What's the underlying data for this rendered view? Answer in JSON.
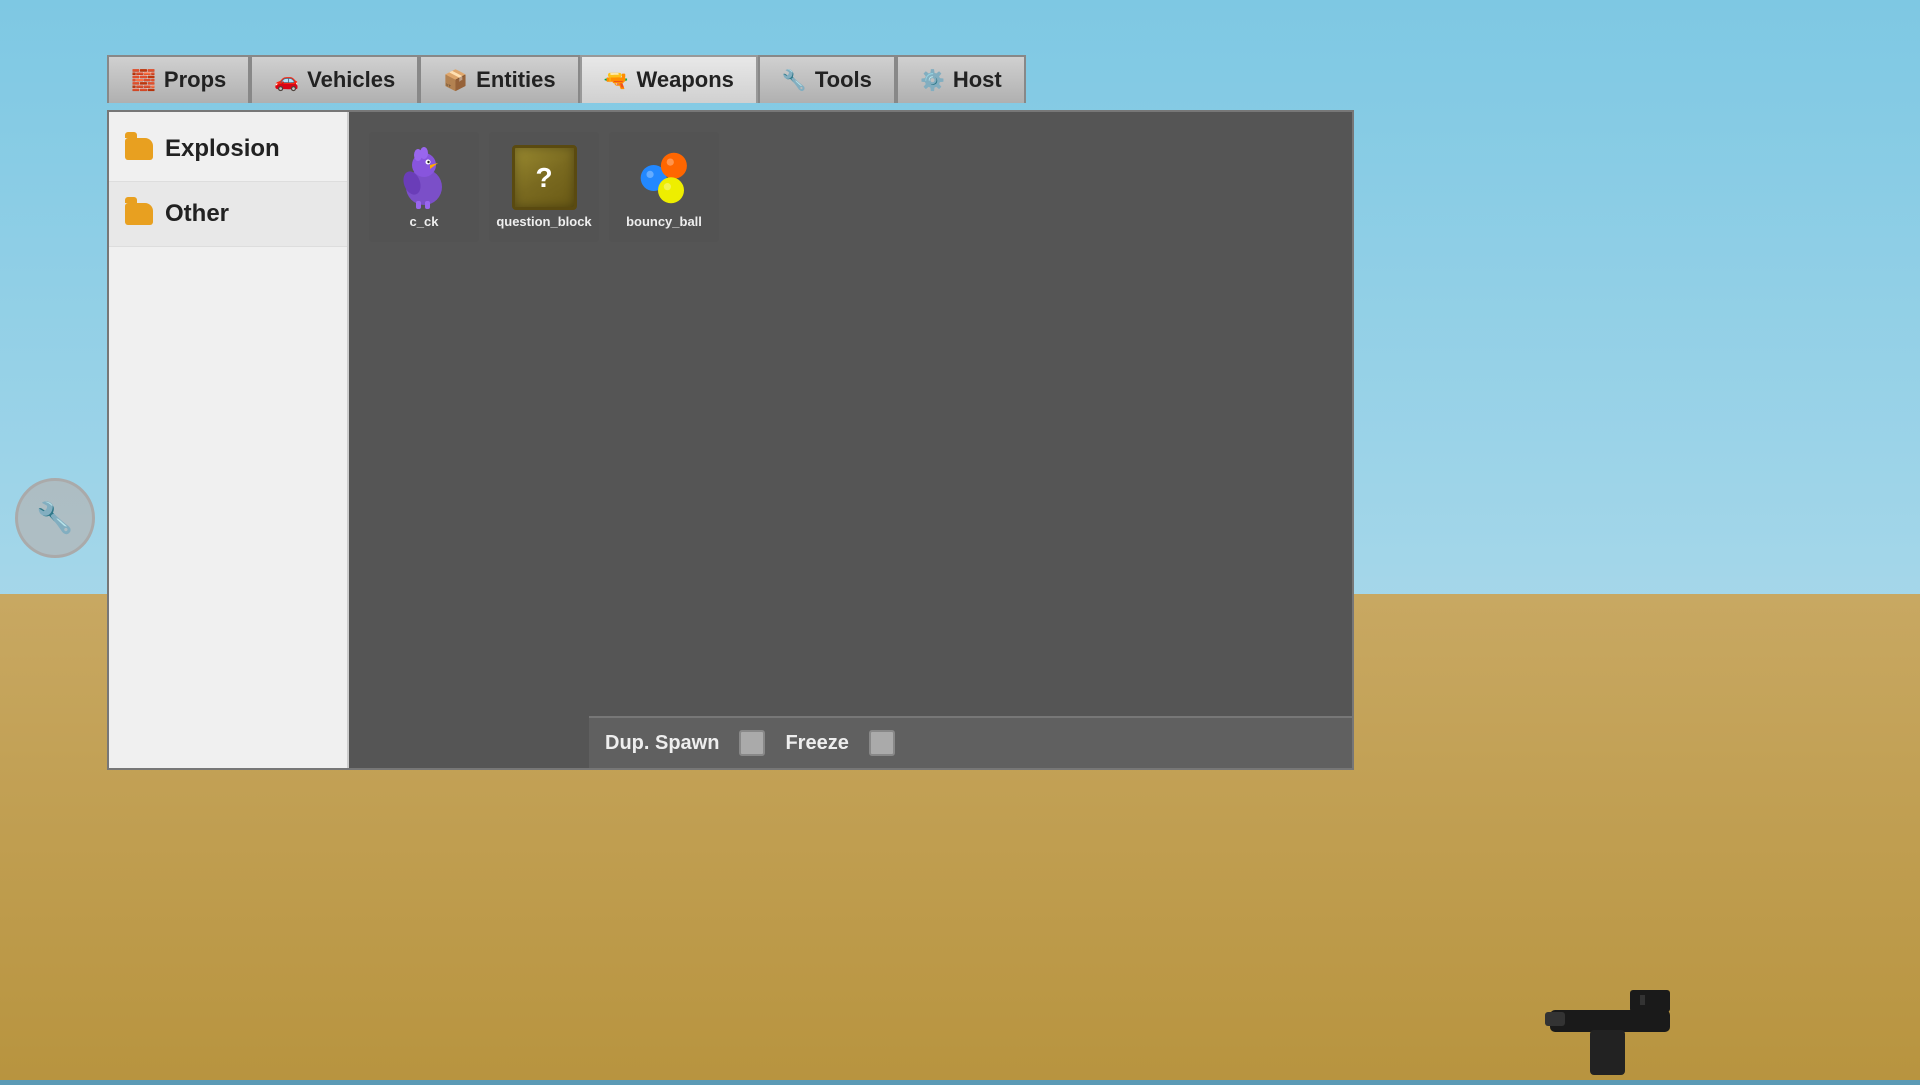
{
  "background": {
    "sky_color": "#7ec8e3",
    "ground_color": "#c8a862"
  },
  "tabs": [
    {
      "id": "props",
      "label": "Props",
      "icon": "🧱",
      "active": false
    },
    {
      "id": "vehicles",
      "label": "Vehicles",
      "icon": "🚗",
      "active": false
    },
    {
      "id": "entities",
      "label": "Entities",
      "icon": "📦",
      "active": false
    },
    {
      "id": "weapons",
      "label": "Weapons",
      "icon": "🔫",
      "active": true
    },
    {
      "id": "tools",
      "label": "Tools",
      "icon": "🔧",
      "active": false
    },
    {
      "id": "host",
      "label": "Host",
      "icon": "⚙️",
      "active": false
    }
  ],
  "sidebar": {
    "items": [
      {
        "id": "explosion",
        "label": "Explosion",
        "active": false
      },
      {
        "id": "other",
        "label": "Other",
        "active": true
      }
    ]
  },
  "content": {
    "items": [
      {
        "id": "c_ck",
        "label": "c_ck"
      },
      {
        "id": "question_block",
        "label": "question_block"
      },
      {
        "id": "bouncy_ball",
        "label": "bouncy_ball"
      }
    ]
  },
  "bottom_bar": {
    "dup_spawn_label": "Dup. Spawn",
    "freeze_label": "Freeze"
  }
}
